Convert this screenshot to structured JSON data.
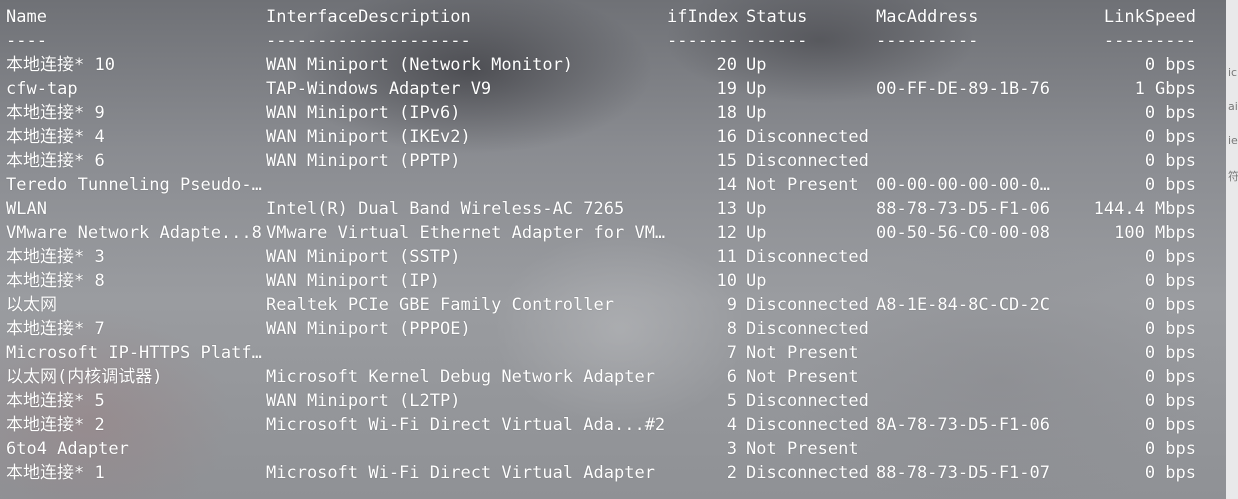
{
  "columns": {
    "name": "Name",
    "description": "InterfaceDescription",
    "ifindex": "ifIndex",
    "status": "Status",
    "mac": "MacAddress",
    "speed": "LinkSpeed"
  },
  "separators": {
    "name": "----",
    "description": "--------------------",
    "ifindex": "-------",
    "status": "------",
    "mac": "----------",
    "speed": "---------"
  },
  "rows": [
    {
      "name": "本地连接* 10",
      "description": "WAN Miniport (Network Monitor)",
      "ifindex": "20",
      "status": "Up",
      "mac": "",
      "speed": "0 bps"
    },
    {
      "name": "cfw-tap",
      "description": "TAP-Windows Adapter V9",
      "ifindex": "19",
      "status": "Up",
      "mac": "00-FF-DE-89-1B-76",
      "speed": "1 Gbps"
    },
    {
      "name": "本地连接* 9",
      "description": "WAN Miniport (IPv6)",
      "ifindex": "18",
      "status": "Up",
      "mac": "",
      "speed": "0 bps"
    },
    {
      "name": "本地连接* 4",
      "description": "WAN Miniport (IKEv2)",
      "ifindex": "16",
      "status": "Disconnected",
      "mac": "",
      "speed": "0 bps"
    },
    {
      "name": "本地连接* 6",
      "description": "WAN Miniport (PPTP)",
      "ifindex": "15",
      "status": "Disconnected",
      "mac": "",
      "speed": "0 bps"
    },
    {
      "name": "Teredo Tunneling Pseudo-…",
      "description": "",
      "ifindex": "14",
      "status": "Not Present",
      "mac": "00-00-00-00-00-0…",
      "speed": "0 bps"
    },
    {
      "name": "WLAN",
      "description": "Intel(R) Dual Band Wireless-AC 7265",
      "ifindex": "13",
      "status": "Up",
      "mac": "88-78-73-D5-F1-06",
      "speed": "144.4 Mbps"
    },
    {
      "name": "VMware Network Adapte...8",
      "description": "VMware Virtual Ethernet Adapter for VM…",
      "ifindex": "12",
      "status": "Up",
      "mac": "00-50-56-C0-00-08",
      "speed": "100 Mbps"
    },
    {
      "name": "本地连接* 3",
      "description": "WAN Miniport (SSTP)",
      "ifindex": "11",
      "status": "Disconnected",
      "mac": "",
      "speed": "0 bps"
    },
    {
      "name": "本地连接* 8",
      "description": "WAN Miniport (IP)",
      "ifindex": "10",
      "status": "Up",
      "mac": "",
      "speed": "0 bps"
    },
    {
      "name": "以太网",
      "description": "Realtek PCIe GBE Family Controller",
      "ifindex": "9",
      "status": "Disconnected",
      "mac": "A8-1E-84-8C-CD-2C",
      "speed": "0 bps"
    },
    {
      "name": "本地连接* 7",
      "description": "WAN Miniport (PPPOE)",
      "ifindex": "8",
      "status": "Disconnected",
      "mac": "",
      "speed": "0 bps"
    },
    {
      "name": "Microsoft IP-HTTPS Platf…",
      "description": "",
      "ifindex": "7",
      "status": "Not Present",
      "mac": "",
      "speed": "0 bps"
    },
    {
      "name": "以太网(内核调试器)",
      "description": "Microsoft Kernel Debug Network Adapter",
      "ifindex": "6",
      "status": "Not Present",
      "mac": "",
      "speed": "0 bps"
    },
    {
      "name": "本地连接* 5",
      "description": "WAN Miniport (L2TP)",
      "ifindex": "5",
      "status": "Disconnected",
      "mac": "",
      "speed": "0 bps"
    },
    {
      "name": "本地连接* 2",
      "description": "Microsoft Wi-Fi Direct Virtual Ada...#2",
      "ifindex": "4",
      "status": "Disconnected",
      "mac": "8A-78-73-D5-F1-06",
      "speed": "0 bps"
    },
    {
      "name": "6to4 Adapter",
      "description": "",
      "ifindex": "3",
      "status": "Not Present",
      "mac": "",
      "speed": "0 bps"
    },
    {
      "name": "本地连接* 1",
      "description": "Microsoft Wi-Fi Direct Virtual Adapter",
      "ifindex": "2",
      "status": "Disconnected",
      "mac": "88-78-73-D5-F1-07",
      "speed": "0 bps"
    }
  ],
  "edge_glyphs": [
    "ic",
    "ai",
    "ie",
    "符"
  ]
}
